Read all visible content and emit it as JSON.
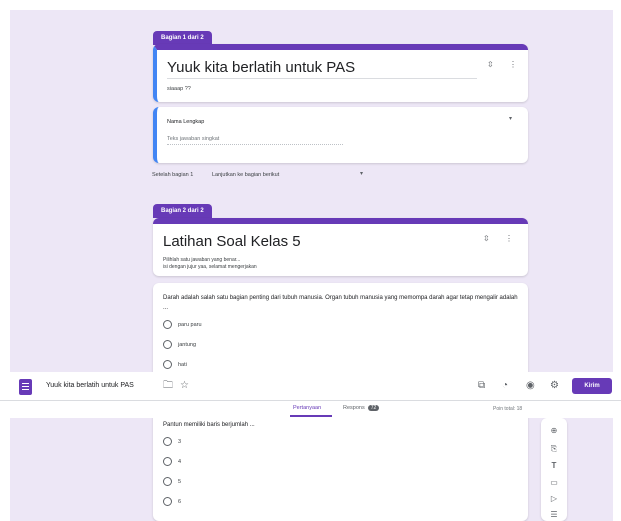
{
  "section1": {
    "tab_label": "Bagian 1 dari 2",
    "title": "Yuuk kita berlatih untuk PAS",
    "description": "siaaap ??",
    "question_label": "Nama Lengkap",
    "answer_placeholder": "Teks jawaban singkat"
  },
  "after_section": {
    "label": "Setelah bagian 1",
    "value": "Lanjutkan ke bagian berikut"
  },
  "section2": {
    "tab_label": "Bagian 2 dari 2",
    "title": "Latihan Soal Kelas 5",
    "description_line1": "Pilihlah satu jawaban yang benar...",
    "description_line2": "isi dengan jujur yaa, selamat mengerjakan"
  },
  "question1": {
    "text": "Darah adalah salah satu bagian penting dari tubuh manusia. Organ tubuh manusia yang memompa darah agar tetap mengalir adalah ...",
    "options": [
      "paru paru",
      "jantung",
      "hati"
    ]
  },
  "appbar": {
    "title": "Yuuk kita berlatih untuk PAS",
    "send_label": "Kirim"
  },
  "tabs": {
    "questions": "Pertanyaan",
    "responses": "Respons",
    "responses_count": "72",
    "points": "Poin total: 18"
  },
  "question2": {
    "text": "Pantun memiliki baris berjumlah ...",
    "options": [
      "3",
      "4",
      "5",
      "6"
    ]
  },
  "icons": {
    "form": "forms-icon",
    "folder": "folder-icon",
    "star": "star-icon",
    "addon": "puzzle-icon",
    "palette": "palette-icon",
    "preview": "eye-icon",
    "settings": "gear-icon"
  },
  "colors": {
    "accent": "#673ab7",
    "canvas": "#ede7f6",
    "active_border": "#4285f4"
  }
}
